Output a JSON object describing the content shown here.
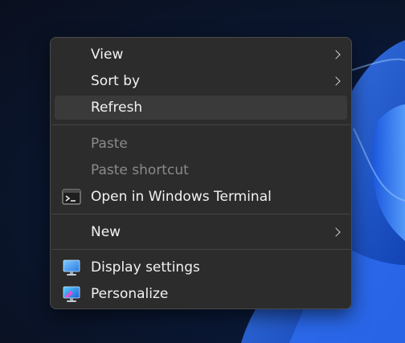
{
  "context_menu": {
    "items": [
      {
        "label": "View",
        "icon": null,
        "submenu": true,
        "disabled": false
      },
      {
        "label": "Sort by",
        "icon": null,
        "submenu": true,
        "disabled": false
      },
      {
        "label": "Refresh",
        "icon": null,
        "submenu": false,
        "disabled": false,
        "hovered": true
      },
      {
        "label": "Paste",
        "icon": null,
        "submenu": false,
        "disabled": true
      },
      {
        "label": "Paste shortcut",
        "icon": null,
        "submenu": false,
        "disabled": true
      },
      {
        "label": "Open in Windows Terminal",
        "icon": "terminal-icon",
        "submenu": false,
        "disabled": false
      },
      {
        "label": "New",
        "icon": null,
        "submenu": true,
        "disabled": false
      },
      {
        "label": "Display settings",
        "icon": "display-settings-icon",
        "submenu": false,
        "disabled": false
      },
      {
        "label": "Personalize",
        "icon": "personalize-icon",
        "submenu": false,
        "disabled": false
      }
    ]
  },
  "colors": {
    "menu_background": "#2c2c2c",
    "hover_background": "#3a3a3a",
    "text": "#f2f2f2",
    "disabled_text": "#8a8a8a",
    "wallpaper_accent": "#1f5bd8"
  }
}
